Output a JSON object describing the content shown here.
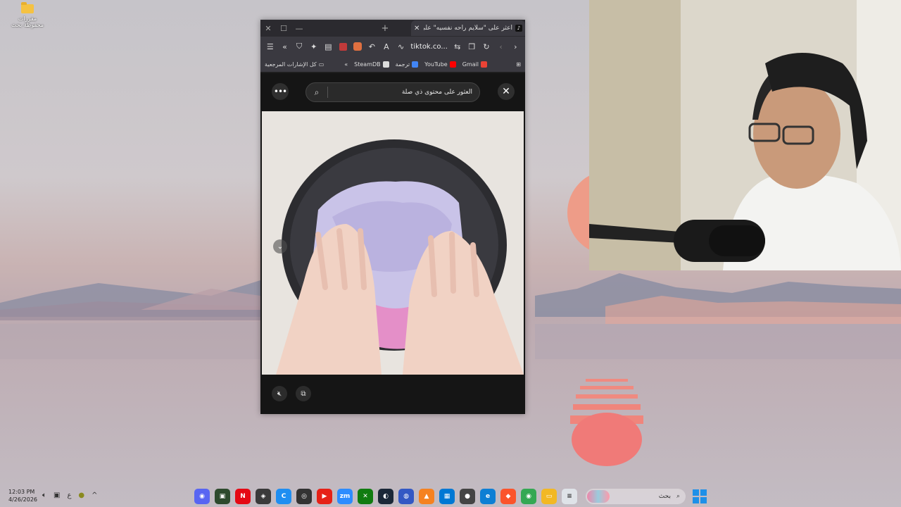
{
  "desktop": {
    "icon_label": "مقررات محفوظة بحث"
  },
  "browser": {
    "tab": {
      "title": "اعثر على \"سلايم راحه نفسيه\" على",
      "icon": "tiktok-icon"
    },
    "window_controls": {
      "close": "✕",
      "maximize": "☐",
      "minimize": "—",
      "new_tab": "+"
    },
    "toolbar": {
      "url": "tiktok.co...",
      "icons": [
        "menu-icon",
        "double-chevron-icon",
        "shield-icon",
        "puzzle-icon",
        "reader-icon",
        "image-icon",
        "extension-icon",
        "undo-icon",
        "translate-icon",
        "font-icon",
        "share-icon",
        "bookmark-icon",
        "reload-icon",
        "back-icon",
        "forward-icon"
      ]
    },
    "bookmarks": {
      "apps_label": "",
      "items": [
        {
          "label": "Gmail",
          "icon": "gmail-icon",
          "color": "#ea4335"
        },
        {
          "label": "YouTube",
          "icon": "youtube-icon",
          "color": "#ff0000"
        },
        {
          "label": "ترجمة",
          "icon": "translate-icon",
          "color": "#4285f4"
        },
        {
          "label": "SteamDB",
          "icon": "steamdb-icon",
          "color": "#dddddd"
        }
      ],
      "overflow": "«",
      "all_bookmarks": "كل الإشارات المرجعية"
    }
  },
  "tiktok": {
    "search_text": "العثور على محتوى ذي صلة",
    "close": "✕",
    "more": "•••",
    "mute_icon": "mute-icon",
    "pip_icon": "pip-icon"
  },
  "taskbar": {
    "time": "12:03 PM",
    "date": "4/26/2026",
    "lang": "ع",
    "search_placeholder": "بحث",
    "apps": [
      {
        "name": "discord",
        "color": "#5865f2",
        "glyph": "◉"
      },
      {
        "name": "terminal",
        "color": "#2d4a2d",
        "glyph": "▣"
      },
      {
        "name": "netflix",
        "color": "#e50914",
        "glyph": "N"
      },
      {
        "name": "davinci",
        "color": "#3a3a3a",
        "glyph": "◈"
      },
      {
        "name": "copilot",
        "color": "#1f8ef1",
        "glyph": "C"
      },
      {
        "name": "obs",
        "color": "#333333",
        "glyph": "◎"
      },
      {
        "name": "youtube-music",
        "color": "#e62117",
        "glyph": "▶"
      },
      {
        "name": "zoom",
        "color": "#2d8cff",
        "glyph": "zm"
      },
      {
        "name": "xbox",
        "color": "#107c10",
        "glyph": "✕"
      },
      {
        "name": "steam",
        "color": "#1b2838",
        "glyph": "◐"
      },
      {
        "name": "ubisoft",
        "color": "#3358c4",
        "glyph": "◍"
      },
      {
        "name": "vlc",
        "color": "#f58220",
        "glyph": "▲"
      },
      {
        "name": "store",
        "color": "#0078d4",
        "glyph": "▦"
      },
      {
        "name": "camera",
        "color": "#444444",
        "glyph": "●"
      },
      {
        "name": "edge",
        "color": "#0d7fd4",
        "glyph": "e"
      },
      {
        "name": "brave",
        "color": "#fb542b",
        "glyph": "◆"
      },
      {
        "name": "chrome",
        "color": "#34a853",
        "glyph": "◉"
      },
      {
        "name": "explorer",
        "color": "#f2b824",
        "glyph": "▭"
      },
      {
        "name": "notepad",
        "color": "#dfe3e8",
        "glyph": "≡"
      }
    ]
  }
}
